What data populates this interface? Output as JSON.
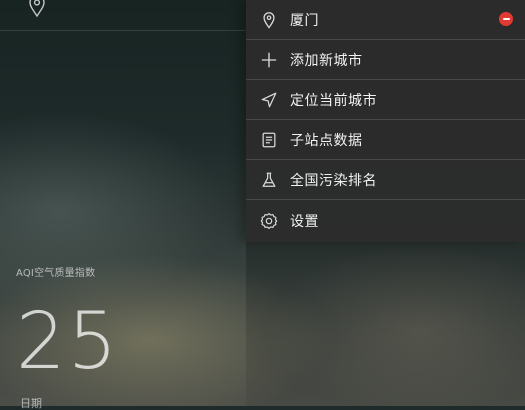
{
  "background": {
    "aqi_label": "AQI空气质量指数",
    "aqi_value": "25",
    "bottom_label": "日期"
  },
  "menu": {
    "items": [
      {
        "label": "厦门",
        "icon": "location-pin-icon",
        "removable": true
      },
      {
        "label": "添加新城市",
        "icon": "plus-icon"
      },
      {
        "label": "定位当前城市",
        "icon": "navigation-arrow-icon"
      },
      {
        "label": "子站点数据",
        "icon": "document-icon"
      },
      {
        "label": "全国污染排名",
        "icon": "flask-icon"
      },
      {
        "label": "设置",
        "icon": "gear-icon"
      }
    ]
  },
  "colors": {
    "menu_bg": "#2c2c2c",
    "remove_badge": "#e03a32"
  }
}
